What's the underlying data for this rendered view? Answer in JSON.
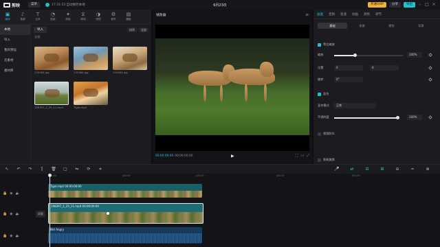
{
  "app": {
    "name": "剪映",
    "menu_label": "菜单",
    "project_status": "17:31:53 自动保存本地",
    "title": "6月23日",
    "pro_label": "开通SVIP",
    "share_label": "分享",
    "export_label": "导出"
  },
  "category_tabs": [
    {
      "label": "媒体",
      "icon": "▣"
    },
    {
      "label": "音频",
      "icon": "♪"
    },
    {
      "label": "文本",
      "icon": "T"
    },
    {
      "label": "贴纸",
      "icon": "◔"
    },
    {
      "label": "特效",
      "icon": "✦"
    },
    {
      "label": "转场",
      "icon": "⧖"
    },
    {
      "label": "滤镜",
      "icon": "◑"
    },
    {
      "label": "调节",
      "icon": "⚙"
    },
    {
      "label": "模板",
      "icon": "▤"
    }
  ],
  "sidebar": {
    "items": [
      "本地",
      "导入",
      "我的预设",
      "云素材",
      "素材库"
    ]
  },
  "media": {
    "import_label": "导入",
    "sort_label": "排序",
    "all_label": "全部",
    "section_label": "全部",
    "items": [
      {
        "name": "135362.jpg"
      },
      {
        "name": "135360.jpg"
      },
      {
        "name": "135364.jpg"
      },
      {
        "name": "198397_1_25_11.mp4"
      },
      {
        "name": "Tiger.mp4"
      }
    ]
  },
  "player": {
    "title": "播放器",
    "timecode_current": "00:00:00:00",
    "timecode_total": "00:00:00:00"
  },
  "right_panel": {
    "tabs": [
      "画面",
      "音频",
      "变速",
      "动画",
      "调色",
      "调节"
    ],
    "subtabs": [
      "基础",
      "抠像",
      "蒙版",
      "背景"
    ],
    "scale_label": "等比缩放",
    "scale_value": "100%",
    "scale_level": 0.3,
    "x_label": "缩放",
    "position_label": "位置",
    "position_x": "0",
    "position_y": "0",
    "rotate_label": "旋转",
    "rotate_value": "0°",
    "blend_label": "混合",
    "blend_mode_label": "混合模式",
    "blend_mode_value": "正常",
    "opacity_label": "不透明度",
    "opacity_value": "100%",
    "opacity_level": 1.0,
    "stabilize_label": "视频防抖",
    "smart_label": "智能美颜"
  },
  "timeline": {
    "ruler_marks": [
      "00:00",
      "|00:05",
      "|00:10",
      "|00:15",
      "|00:20"
    ],
    "cover_label": "封面",
    "clips": [
      {
        "label": "Tiger.mp4  00:00:00:00"
      },
      {
        "label": "198397_1_25_11.mp4  00:00:00:00"
      },
      {
        "label": "Not Angry"
      }
    ]
  },
  "colors": {
    "accent": "#23c0d0",
    "background": "#0f0f12",
    "panel": "#1b1b20"
  }
}
